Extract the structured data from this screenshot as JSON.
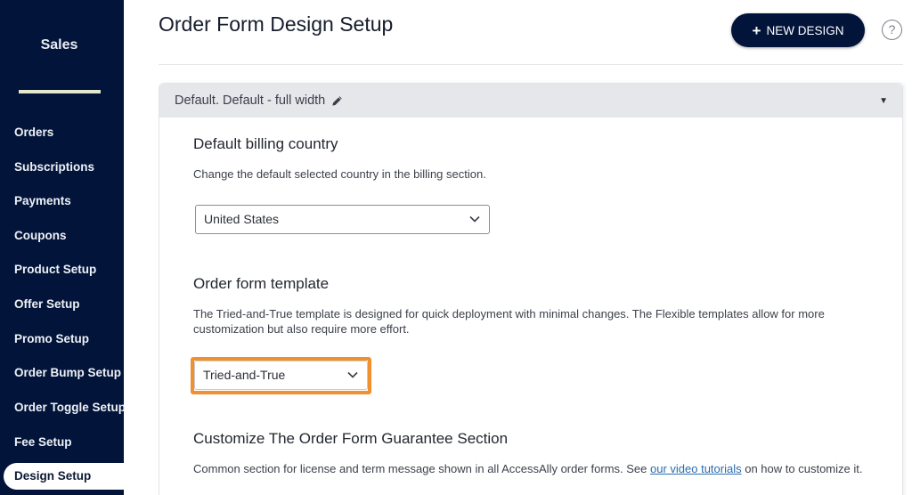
{
  "sidebar": {
    "title": "Sales",
    "items": [
      {
        "label": "Orders",
        "active": false
      },
      {
        "label": "Subscriptions",
        "active": false
      },
      {
        "label": "Payments",
        "active": false
      },
      {
        "label": "Coupons",
        "active": false
      },
      {
        "label": "Product Setup",
        "active": false
      },
      {
        "label": "Offer Setup",
        "active": false
      },
      {
        "label": "Promo Setup",
        "active": false
      },
      {
        "label": "Order Bump Setup",
        "active": false
      },
      {
        "label": "Order Toggle Setup",
        "active": false
      },
      {
        "label": "Fee Setup",
        "active": false
      },
      {
        "label": "Design Setup",
        "active": true
      }
    ]
  },
  "header": {
    "title": "Order Form Design Setup",
    "new_design_label": "NEW DESIGN",
    "new_design_icon": "plus-icon",
    "help_icon": "?"
  },
  "panel": {
    "title": "Default. Default - full width",
    "edit_icon": "pencil-icon",
    "collapse_icon": "▼",
    "billing": {
      "heading": "Default billing country",
      "description": "Change the default selected country in the billing section.",
      "selected": "United States"
    },
    "template": {
      "heading": "Order form template",
      "description": "The Tried-and-True template is designed for quick deployment with minimal changes. The Flexible templates allow for more customization but also require more effort.",
      "selected": "Tried-and-True",
      "highlight_color": "#f0902f"
    },
    "guarantee": {
      "heading": "Customize The Order Form Guarantee Section",
      "description_before": "Common section for license and term message shown in all AccessAlly order forms. See ",
      "link_text": "our video tutorials",
      "description_after": " on how to customize it."
    }
  },
  "colors": {
    "sidebar_bg": "#02143a",
    "accent_button": "#02143a",
    "highlight": "#f0902f",
    "link": "#2a6cb0"
  }
}
